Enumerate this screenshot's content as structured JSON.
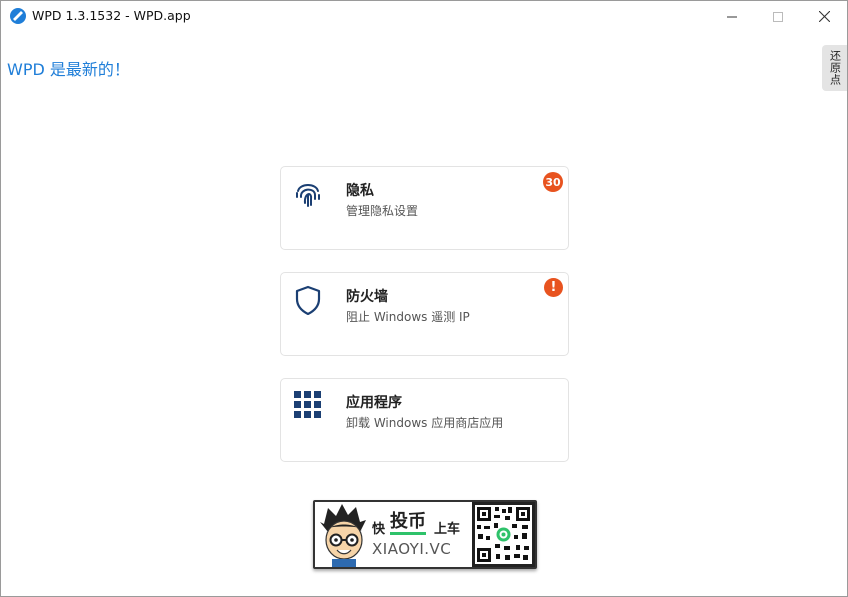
{
  "window": {
    "title": "WPD 1.3.1532 - WPD.app",
    "controls": {
      "minimize": "minimize-icon",
      "maximize": "maximize-icon",
      "close": "close-icon"
    }
  },
  "status_message": "WPD 是最新的！",
  "restore_point_label": "还原点",
  "cards": [
    {
      "icon": "fingerprint-icon",
      "title": "隐私",
      "subtitle": "管理隐私设置",
      "badge": "30"
    },
    {
      "icon": "shield-icon",
      "title": "防火墙",
      "subtitle": "阻止 Windows 遥测 IP",
      "badge": "!"
    },
    {
      "icon": "grid-apps-icon",
      "title": "应用程序",
      "subtitle": "卸载 Windows 应用商店应用"
    }
  ],
  "banner": {
    "line1_a": "快",
    "line1_b": "投币",
    "line1_c": "上车",
    "site": "XIAOYI.VC"
  },
  "colors": {
    "accent": "#1f7ed8",
    "badge": "#e8531f",
    "icon": "#1b3f73",
    "banner_green": "#2ec26a"
  }
}
